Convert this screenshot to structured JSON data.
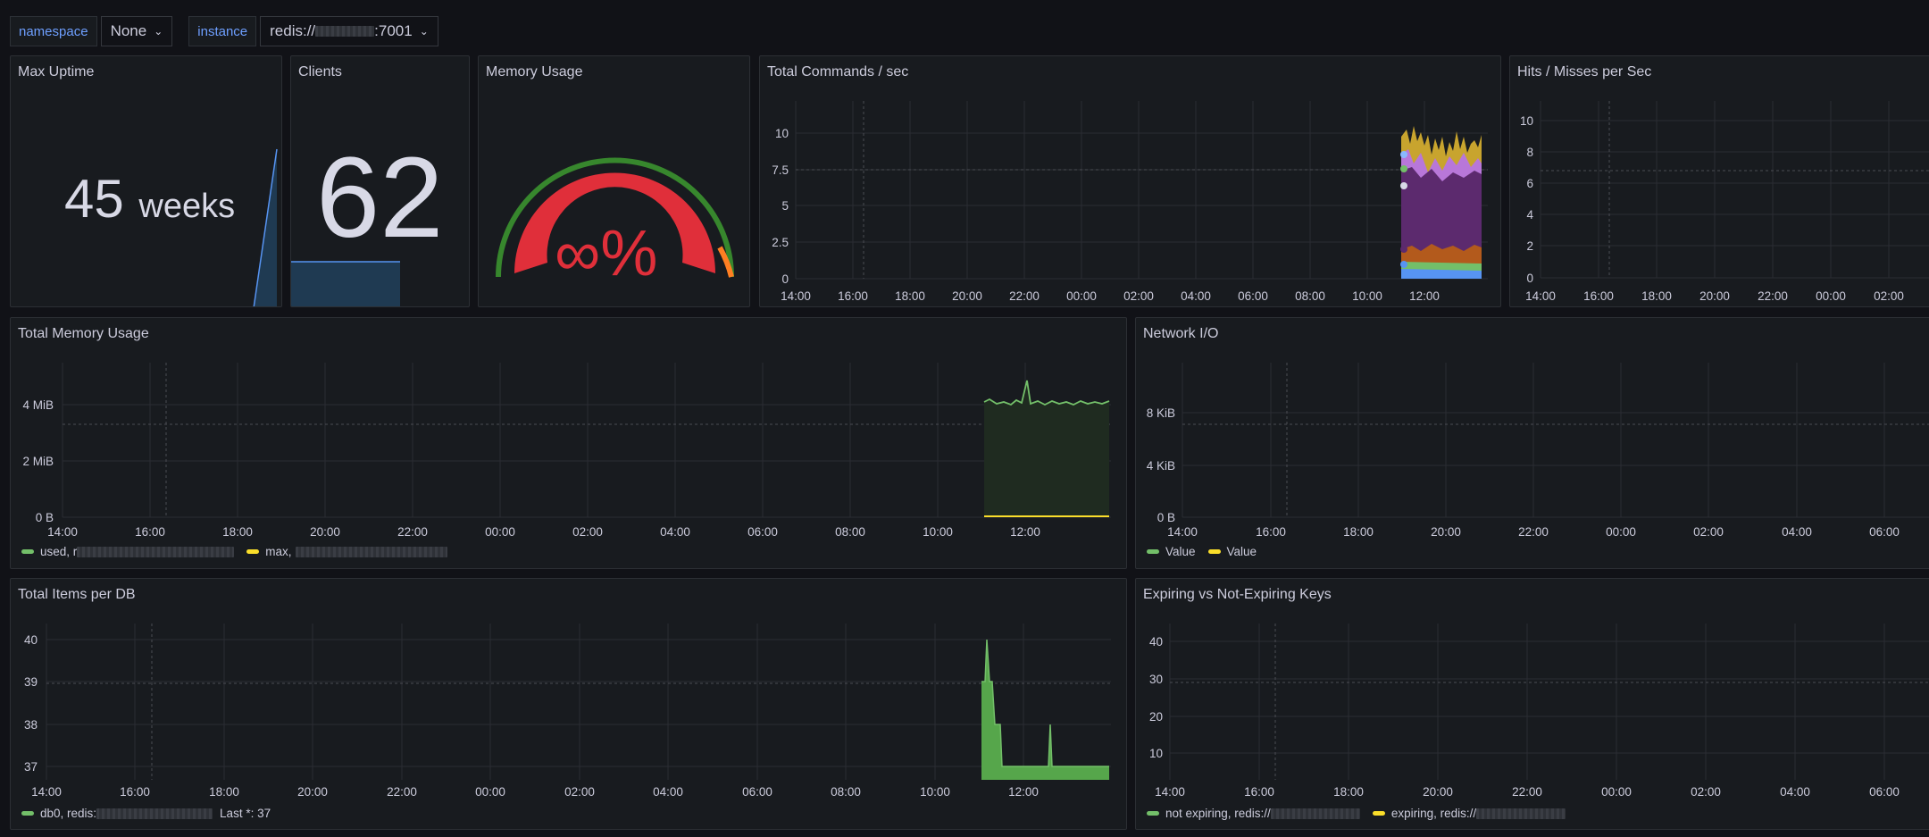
{
  "variables": {
    "namespace_label": "namespace",
    "namespace_value": "None",
    "instance_label": "instance",
    "instance_prefix": "redis://",
    "instance_suffix": ":7001"
  },
  "panels": {
    "max_uptime": {
      "title": "Max Uptime",
      "value": "45",
      "unit": "weeks"
    },
    "clients": {
      "title": "Clients",
      "value": "62"
    },
    "memory_usage": {
      "title": "Memory Usage",
      "value": "∞%"
    },
    "total_commands": {
      "title": "Total Commands / sec",
      "yticks": [
        "10",
        "7.5",
        "5",
        "2.5",
        "0"
      ],
      "xticks": [
        "14:00",
        "16:00",
        "18:00",
        "20:00",
        "22:00",
        "00:00",
        "02:00",
        "04:00",
        "06:00",
        "08:00",
        "10:00",
        "12:00"
      ]
    },
    "hits_misses": {
      "title": "Hits / Misses per Sec",
      "yticks": [
        "10",
        "8",
        "6",
        "4",
        "2",
        "0"
      ],
      "xticks": [
        "14:00",
        "16:00",
        "18:00",
        "20:00",
        "22:00",
        "00:00",
        "02:00"
      ]
    },
    "total_memory": {
      "title": "Total Memory Usage",
      "yticks": [
        "4 MiB",
        "2 MiB",
        "0 B"
      ],
      "xticks": [
        "14:00",
        "16:00",
        "18:00",
        "20:00",
        "22:00",
        "00:00",
        "02:00",
        "04:00",
        "06:00",
        "08:00",
        "10:00",
        "12:00"
      ],
      "legend": [
        "used, r",
        "max, "
      ]
    },
    "network_io": {
      "title": "Network I/O",
      "yticks": [
        "8 KiB",
        "4 KiB",
        "0 B"
      ],
      "xticks": [
        "14:00",
        "16:00",
        "18:00",
        "20:00",
        "22:00",
        "00:00",
        "02:00",
        "04:00",
        "06:00"
      ],
      "legend": [
        "Value",
        "Value"
      ]
    },
    "items_per_db": {
      "title": "Total Items per DB",
      "yticks": [
        "40",
        "39",
        "38",
        "37"
      ],
      "xticks": [
        "14:00",
        "16:00",
        "18:00",
        "20:00",
        "22:00",
        "00:00",
        "02:00",
        "04:00",
        "06:00",
        "08:00",
        "10:00",
        "12:00"
      ],
      "legend_name": "db0, redis:",
      "legend_last": "Last *: 37"
    },
    "expiring_keys": {
      "title": "Expiring vs Not-Expiring Keys",
      "yticks": [
        "40",
        "30",
        "20",
        "10"
      ],
      "xticks": [
        "14:00",
        "16:00",
        "18:00",
        "20:00",
        "22:00",
        "00:00",
        "02:00",
        "04:00",
        "06:00"
      ],
      "legend": [
        "not expiring, redis://",
        "expiring, redis://"
      ]
    }
  },
  "colors": {
    "green": "#73bf69",
    "yellow": "#fade2a",
    "red": "#f2495c",
    "purple": "#5c2a6e",
    "orange": "#ff9830",
    "blue": "#5794f2"
  }
}
